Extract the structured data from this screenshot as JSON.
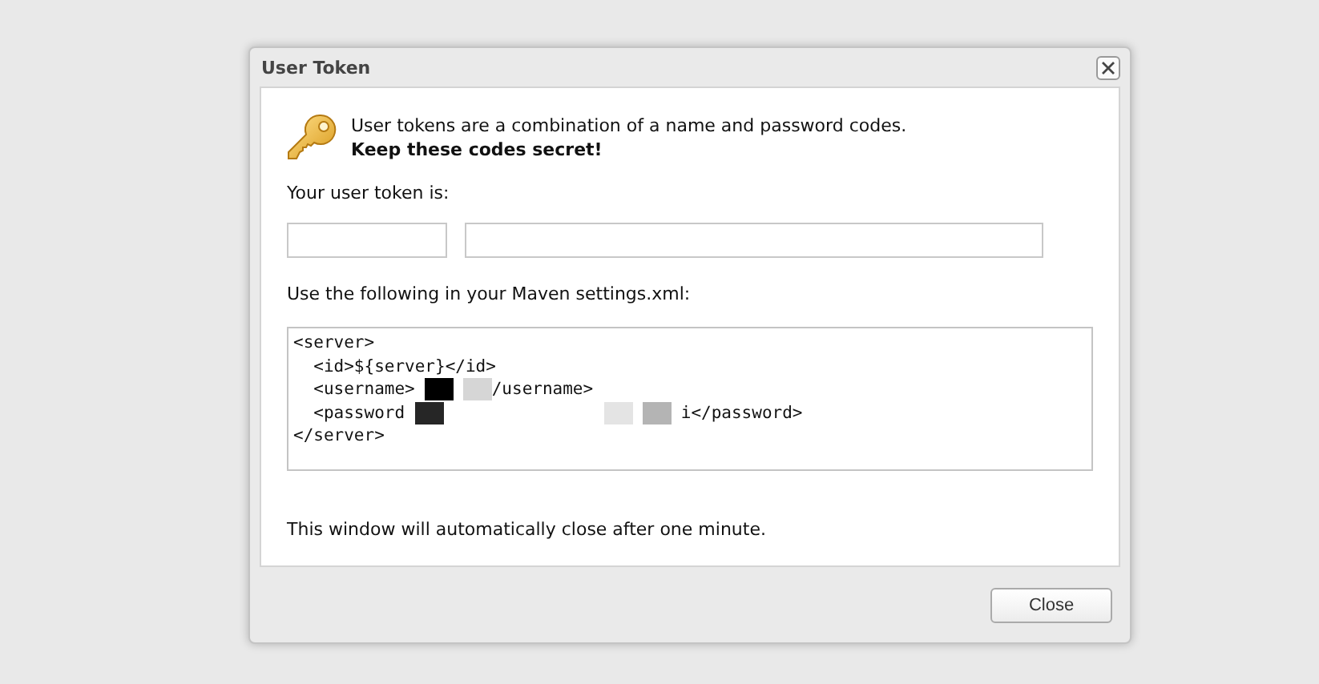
{
  "window": {
    "title": "User Token"
  },
  "intro": {
    "text": "User tokens are a combination of a name and password codes.",
    "warning": "Keep these codes secret!"
  },
  "token_label": "Your user token is:",
  "token_fields": [
    {
      "kind": "name"
    },
    {
      "kind": "password"
    }
  ],
  "settings_label": "Use the following in your Maven settings.xml:",
  "code_lines": [
    [
      {
        "kind": "text",
        "text": "<server>"
      }
    ],
    [
      {
        "kind": "text",
        "text": "  <id>${server}</id>"
      }
    ],
    [
      {
        "kind": "text",
        "text": "  <username>"
      },
      {
        "kind": "mask",
        "color": "#000000"
      },
      {
        "kind": "mask",
        "color": "#d6d6d6"
      },
      {
        "kind": "text",
        "text": "/username>"
      }
    ],
    [
      {
        "kind": "text",
        "text": "  <password"
      },
      {
        "kind": "mask",
        "color": "#262626"
      },
      {
        "kind": "mask",
        "color": "#e4e4e4"
      },
      {
        "kind": "mask",
        "color": "#b4b4b4"
      },
      {
        "kind": "text",
        "text": " i</password>"
      }
    ],
    [
      {
        "kind": "text",
        "text": "</server>"
      }
    ]
  ],
  "notice": "This window will automatically close after one minute.",
  "buttons": [
    {
      "label": "Close"
    }
  ]
}
